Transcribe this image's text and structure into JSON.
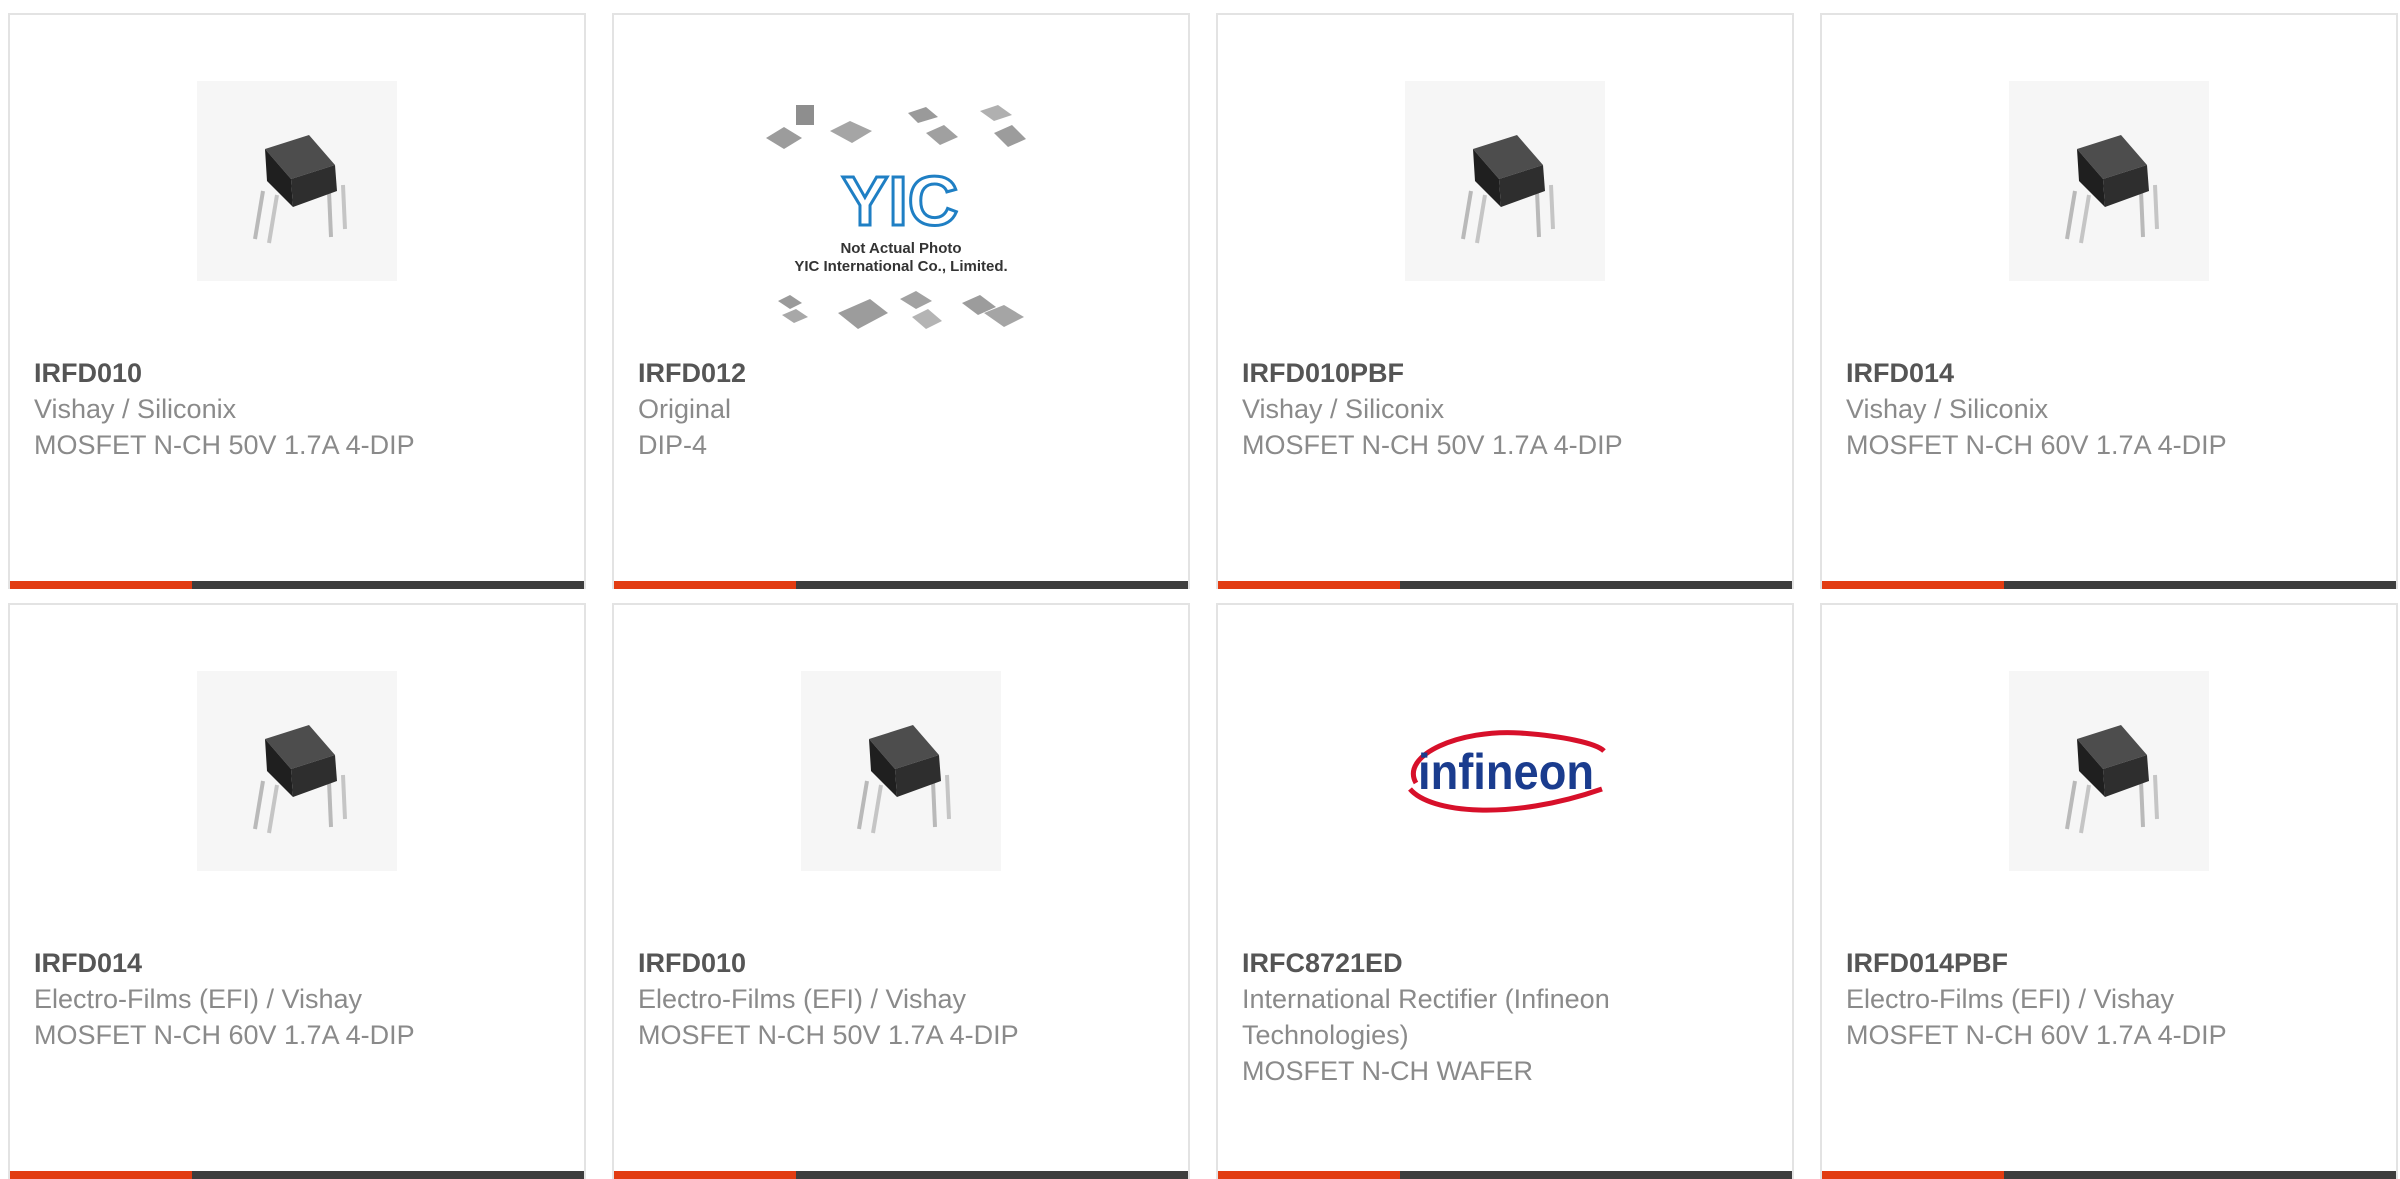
{
  "products": [
    {
      "part": "IRFD010",
      "manufacturer": "Vishay / Siliconix",
      "description": "MOSFET N-CH 50V 1.7A 4-DIP",
      "image": "dip-chip"
    },
    {
      "part": "IRFD012",
      "manufacturer": "Original",
      "description": "DIP-4",
      "image": "yic-placeholder",
      "image_text": {
        "logo": "YIC",
        "line1": "Not Actual Photo",
        "line2": "YIC International Co., Limited."
      }
    },
    {
      "part": "IRFD010PBF",
      "manufacturer": "Vishay / Siliconix",
      "description": "MOSFET N-CH 50V 1.7A 4-DIP",
      "image": "dip-chip"
    },
    {
      "part": "IRFD014",
      "manufacturer": "Vishay / Siliconix",
      "description": "MOSFET N-CH 60V 1.7A 4-DIP",
      "image": "dip-chip"
    },
    {
      "part": "IRFD014",
      "manufacturer": "Electro-Films (EFI) / Vishay",
      "description": "MOSFET N-CH 60V 1.7A 4-DIP",
      "image": "dip-chip"
    },
    {
      "part": "IRFD010",
      "manufacturer": "Electro-Films (EFI) / Vishay",
      "description": "MOSFET N-CH 50V 1.7A 4-DIP",
      "image": "dip-chip"
    },
    {
      "part": "IRFC8721ED",
      "manufacturer": "International Rectifier (Infineon Technologies)",
      "description": "MOSFET N-CH WAFER",
      "image": "infineon-logo",
      "image_text": {
        "logo": "infineon"
      }
    },
    {
      "part": "IRFD014PBF",
      "manufacturer": "Electro-Films (EFI) / Vishay",
      "description": "MOSFET N-CH 60V 1.7A 4-DIP",
      "image": "dip-chip"
    }
  ],
  "colors": {
    "accent": "#e23c12",
    "bar": "#3d3d3d",
    "part_text": "#555555",
    "secondary_text": "#8a8a8a",
    "card_border": "#e3e3e3",
    "yic_blue": "#1f7fc4",
    "infineon_blue": "#1a3c8e",
    "infineon_red": "#d7102a"
  }
}
